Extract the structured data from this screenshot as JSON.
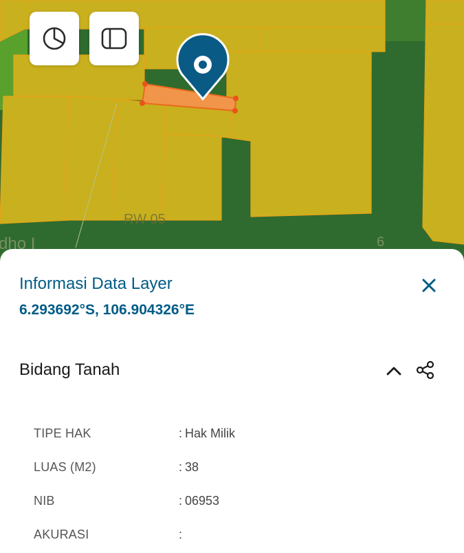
{
  "map": {
    "street_labels": [
      "RW 05",
      "dho I",
      "6"
    ],
    "controls": {
      "chart_icon": "pie-chart-icon",
      "panel_icon": "sidebar-panel-icon"
    },
    "marker_icon": "map-pin-icon",
    "colors": {
      "background_green": "#2f6b2e",
      "parcel_fill": "#c9b01e",
      "parcel_stroke": "#e8a317",
      "selected_parcel": "#f0954a",
      "vertex": "#e8541c",
      "marker": "#0a5a86"
    }
  },
  "sheet": {
    "title": "Informasi Data Layer",
    "coordinates": "6.293692°S, 106.904326°E",
    "close_icon": "close-icon",
    "section": {
      "title": "Bidang Tanah",
      "collapse_icon": "chevron-up-icon",
      "share_icon": "share-icon",
      "attributes": [
        {
          "key": "TIPE HAK",
          "value": "Hak Milik"
        },
        {
          "key": "LUAS (M2)",
          "value": "38"
        },
        {
          "key": "NIB",
          "value": "06953"
        },
        {
          "key": "AKURASI",
          "value": ""
        }
      ]
    }
  },
  "colors": {
    "accent": "#005b86",
    "text_dark": "#1a1a1a",
    "text_muted": "#555555"
  }
}
